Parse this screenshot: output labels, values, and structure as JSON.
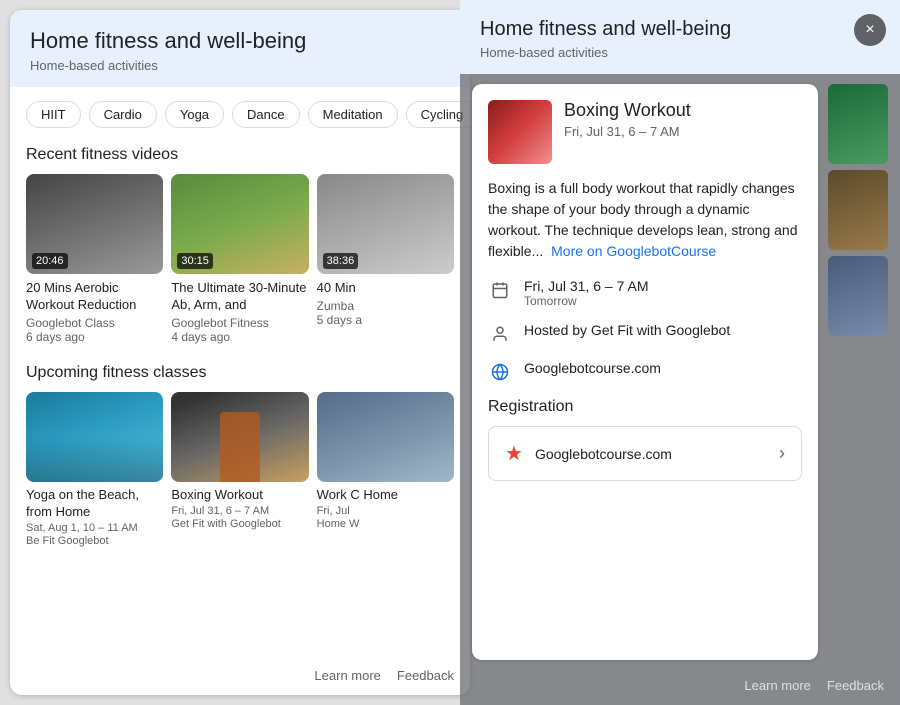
{
  "left": {
    "header": {
      "title": "Home fitness and well-being",
      "subtitle": "Home-based activities"
    },
    "chips": [
      "HIIT",
      "Cardio",
      "Yoga",
      "Dance",
      "Meditation",
      "Cycling"
    ],
    "recent_videos": {
      "label": "Recent fitness videos",
      "items": [
        {
          "duration": "20:46",
          "title": "20 Mins Aerobic Workout Reduction",
          "channel": "Googlebot Class",
          "ago": "6 days ago"
        },
        {
          "duration": "30:15",
          "title": "The Ultimate 30-Minute Ab, Arm, and",
          "channel": "Googlebot Fitness",
          "ago": "4 days ago"
        },
        {
          "duration": "38:36",
          "title": "40 Min",
          "channel": "Zumba",
          "ago": "5 days a"
        }
      ]
    },
    "upcoming_classes": {
      "label": "Upcoming fitness classes",
      "items": [
        {
          "title": "Yoga on the Beach, from Home",
          "date": "Sat, Aug 1, 10 – 11 AM",
          "host": "Be Fit Googlebot"
        },
        {
          "title": "Boxing Workout",
          "date": "Fri, Jul 31, 6 – 7 AM",
          "host": "Get Fit with Googlebot"
        },
        {
          "title": "Work C Home",
          "date": "Fri, Jul",
          "host": "Home W"
        }
      ]
    },
    "footer": {
      "learn_more": "Learn more",
      "feedback": "Feedback"
    }
  },
  "right": {
    "header": {
      "title": "Home fitness and well-being",
      "subtitle": "Home-based activities"
    },
    "close_label": "×",
    "event": {
      "title": "Boxing Workout",
      "date_header": "Fri, Jul 31, 6 – 7 AM",
      "description": "Boxing is a full body workout that rapidly changes the shape of your body through a dynamic workout. The technique develops lean, strong and flexible...",
      "more_link": "More on GooglebotCourse",
      "date_line": "Fri, Jul 31, 6 – 7 AM",
      "date_sub": "Tomorrow",
      "host": "Hosted by Get Fit with Googlebot",
      "website": "Googlebotcourse.com",
      "registration_label": "Registration",
      "registration_site": "Googlebotcourse.com"
    },
    "footer": {
      "learn_more": "Learn more",
      "feedback": "Feedback"
    }
  }
}
